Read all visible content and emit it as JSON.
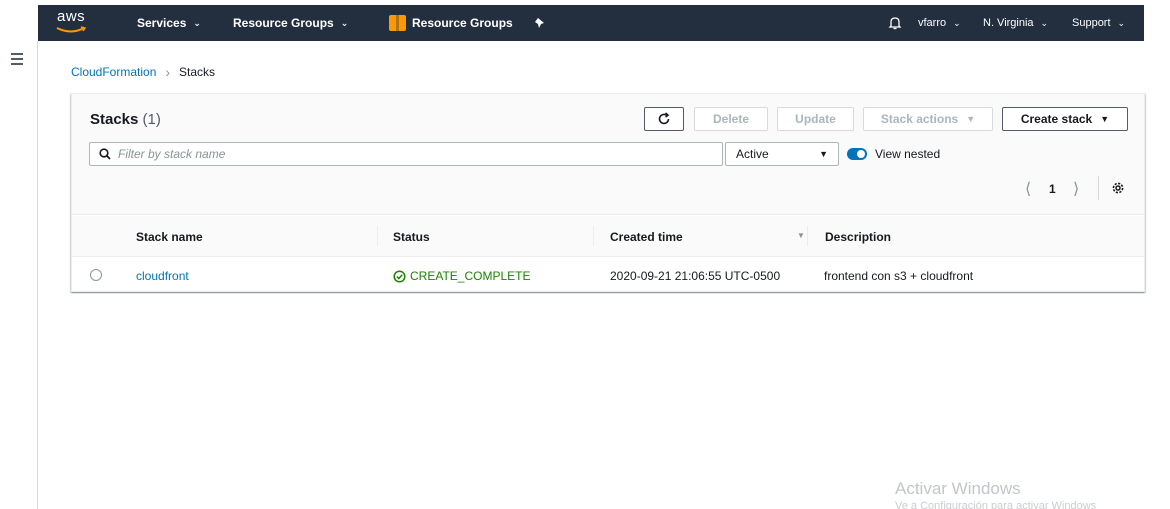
{
  "topnav": {
    "logo": "aws",
    "services": "Services",
    "resource_groups_menu": "Resource Groups",
    "resource_groups_link": "Resource Groups",
    "user": "vfarro",
    "region": "N. Virginia",
    "support": "Support",
    "colors": {
      "bg": "#232f3e",
      "accent": "#ff9900"
    }
  },
  "breadcrumb": {
    "parent": "CloudFormation",
    "current": "Stacks"
  },
  "stacks_panel": {
    "title": "Stacks",
    "count": "(1)",
    "buttons": {
      "delete": "Delete",
      "update": "Update",
      "stack_actions": "Stack actions",
      "create_stack": "Create stack"
    },
    "search": {
      "placeholder": "Filter by stack name",
      "value": ""
    },
    "filter_select": {
      "selected": "Active"
    },
    "view_nested": {
      "label": "View nested",
      "enabled": true
    },
    "pagination": {
      "current_page": "1"
    }
  },
  "table": {
    "columns": [
      "Stack name",
      "Status",
      "Created time",
      "Description"
    ],
    "rows": [
      {
        "stack_name": "cloudfront",
        "status": "CREATE_COMPLETE",
        "created_time": "2020-09-21 21:06:55 UTC-0500",
        "description": "frontend con s3 + cloudfront"
      }
    ]
  },
  "watermark": {
    "title": "Activar Windows",
    "subtitle": "Ve a Configuración para activar Windows"
  },
  "colors": {
    "link": "#0073bb",
    "success": "#1d8102",
    "toggle_on": "#0073bb"
  }
}
